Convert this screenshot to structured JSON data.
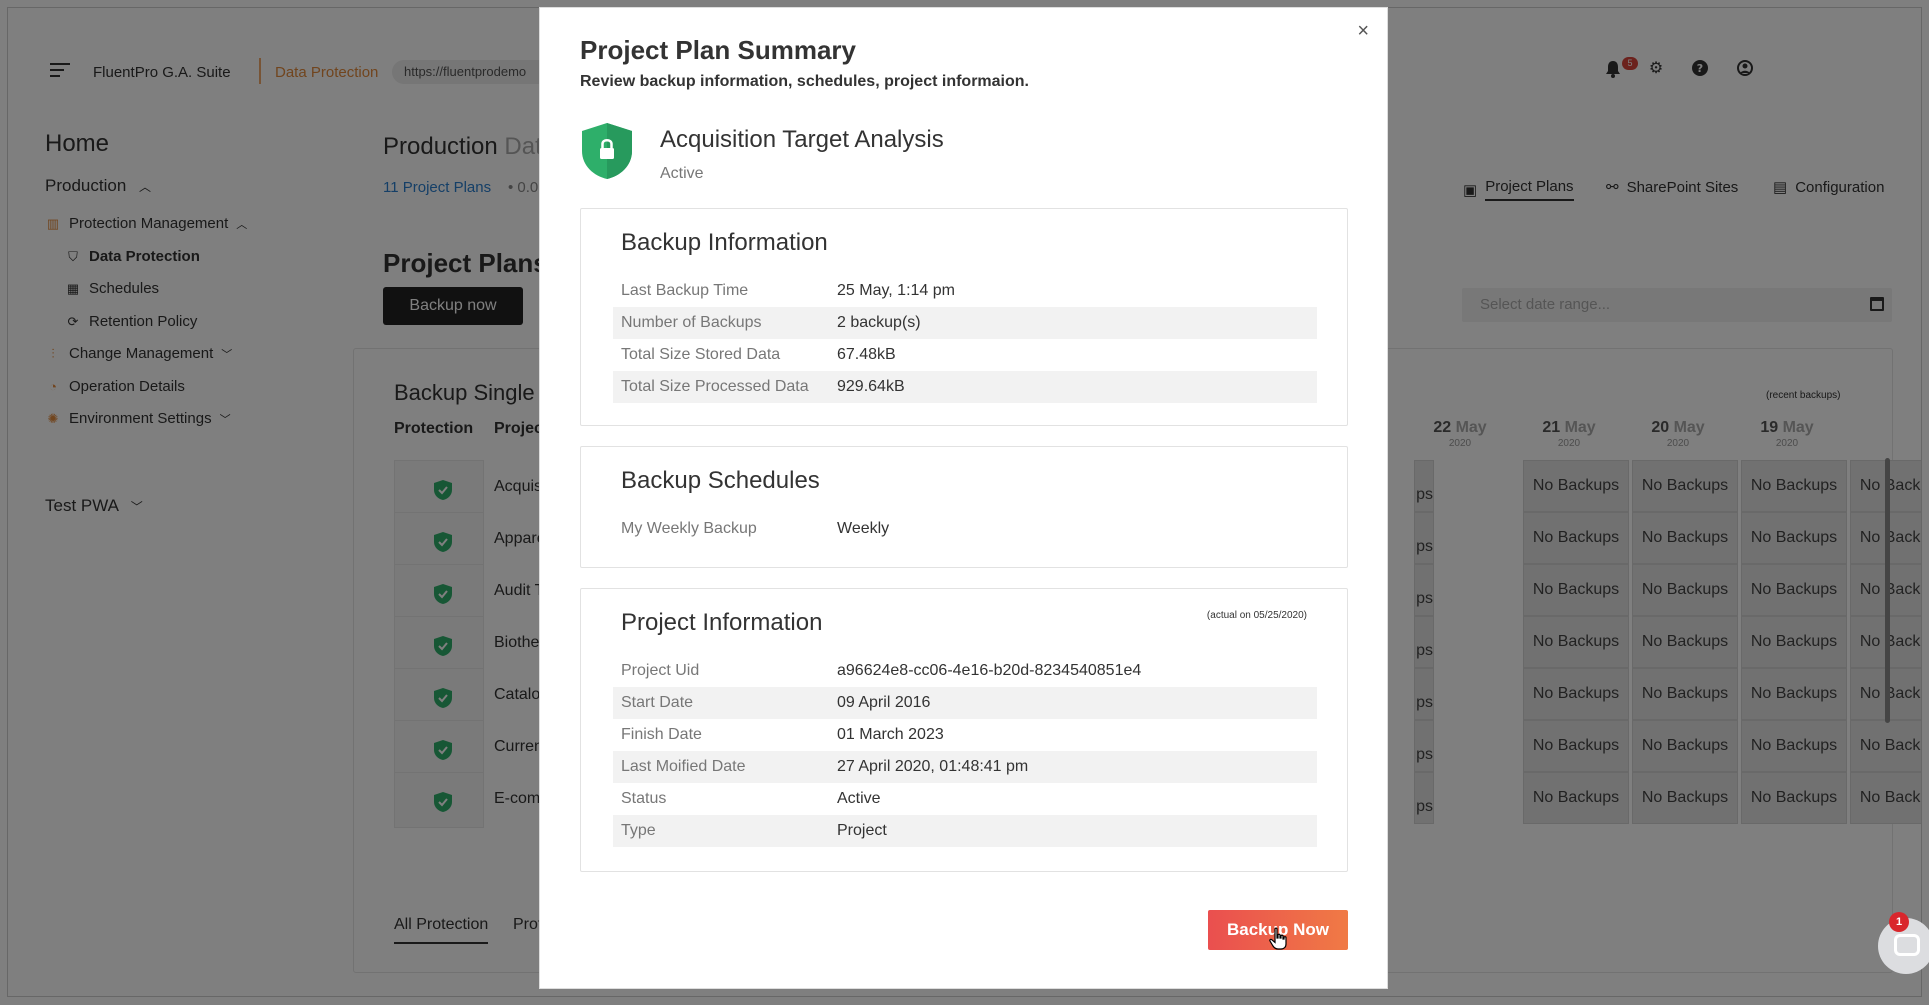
{
  "header": {
    "suite_name": "FluentPro G.A. Suite",
    "module_name": "Data Protection",
    "url": "https://fluentprodemo",
    "notification_count": "5"
  },
  "sidebar": {
    "home": "Home",
    "production": "Production",
    "protection_management": "Protection Management",
    "data_protection": "Data Protection",
    "schedules": "Schedules",
    "retention_policy": "Retention Policy",
    "change_management": "Change Management",
    "operation_details": "Operation Details",
    "environment_settings": "Environment Settings",
    "test_pwa": "Test PWA"
  },
  "main": {
    "title": "Production",
    "title_fade": "Data",
    "project_plans_link": "11 Project Plans",
    "sub_info": "• 0.0",
    "project_plans_heading": "Project Plans",
    "backup_now_label": "Backup now",
    "nav_tabs": [
      "Project Plans",
      "SharePoint Sites",
      "Configuration"
    ],
    "date_range_placeholder": "Select date range...",
    "backup_single": "Backup Single",
    "col_protection": "Protection",
    "col_project": "Projec",
    "recent_backups": "(recent backups)",
    "dates": [
      {
        "day": "22",
        "month": "May",
        "year": "2020"
      },
      {
        "day": "21",
        "month": "May",
        "year": "2020"
      },
      {
        "day": "20",
        "month": "May",
        "year": "2020"
      },
      {
        "day": "19",
        "month": "May",
        "year": "2020"
      }
    ],
    "no_backups": "No Backups",
    "rows": [
      "Acquisi",
      "Appare",
      "Audit Tr",
      "Biother",
      "Catalog",
      "Curren",
      "E-comn"
    ],
    "bottom_tabs": [
      "All Protection",
      "Prote"
    ]
  },
  "modal": {
    "title": "Project Plan Summary",
    "subtitle": "Review backup information, schedules, project informaion.",
    "project_name": "Acquisition Target Analysis",
    "project_status": "Active",
    "backup_info": {
      "title": "Backup Information",
      "rows": [
        {
          "k": "Last Backup Time",
          "v": "25 May, 1:14 pm"
        },
        {
          "k": "Number of Backups",
          "v": "2 backup(s)"
        },
        {
          "k": "Total Size Stored Data",
          "v": "67.48kB"
        },
        {
          "k": "Total Size Processed Data",
          "v": "929.64kB"
        }
      ]
    },
    "schedules": {
      "title": "Backup Schedules",
      "rows": [
        {
          "k": "My Weekly Backup",
          "v": "Weekly"
        }
      ]
    },
    "project_info": {
      "title": "Project Information",
      "note": "(actual on 05/25/2020)",
      "rows": [
        {
          "k": "Project Uid",
          "v": "a96624e8-cc06-4e16-b20d-8234540851e4"
        },
        {
          "k": "Start Date",
          "v": "09 April 2016"
        },
        {
          "k": "Finish Date",
          "v": "01 March 2023"
        },
        {
          "k": "Last Moified Date",
          "v": "27 April 2020, 01:48:41 pm"
        },
        {
          "k": "Status",
          "v": "Active"
        },
        {
          "k": "Type",
          "v": "Project"
        }
      ]
    },
    "backup_now_label": "Backup Now",
    "close_symbol": "×"
  },
  "chat": {
    "badge": "1"
  },
  "colors": {
    "accent_orange": "#e38a3c",
    "shield_green": "#2eaf6a",
    "button_gradient_start": "#ea4f4f",
    "button_gradient_end": "#f07a45"
  }
}
